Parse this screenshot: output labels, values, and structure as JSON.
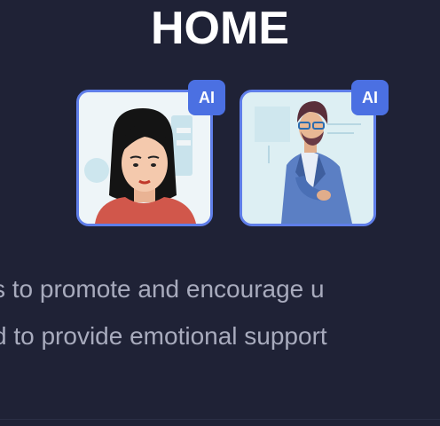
{
  "page": {
    "title": "HOME"
  },
  "avatars": [
    {
      "badge": "AI",
      "icon": "woman-avatar-icon"
    },
    {
      "badge": "AI",
      "icon": "businessman-avatar-icon"
    }
  ],
  "description": {
    "line1": "s to promote and encourage u",
    "line2": "d to provide emotional support"
  },
  "colors": {
    "background": "#1f2236",
    "accent": "#4b70e2",
    "card_border": "#5f7ee9",
    "text": "#a8abbd"
  }
}
